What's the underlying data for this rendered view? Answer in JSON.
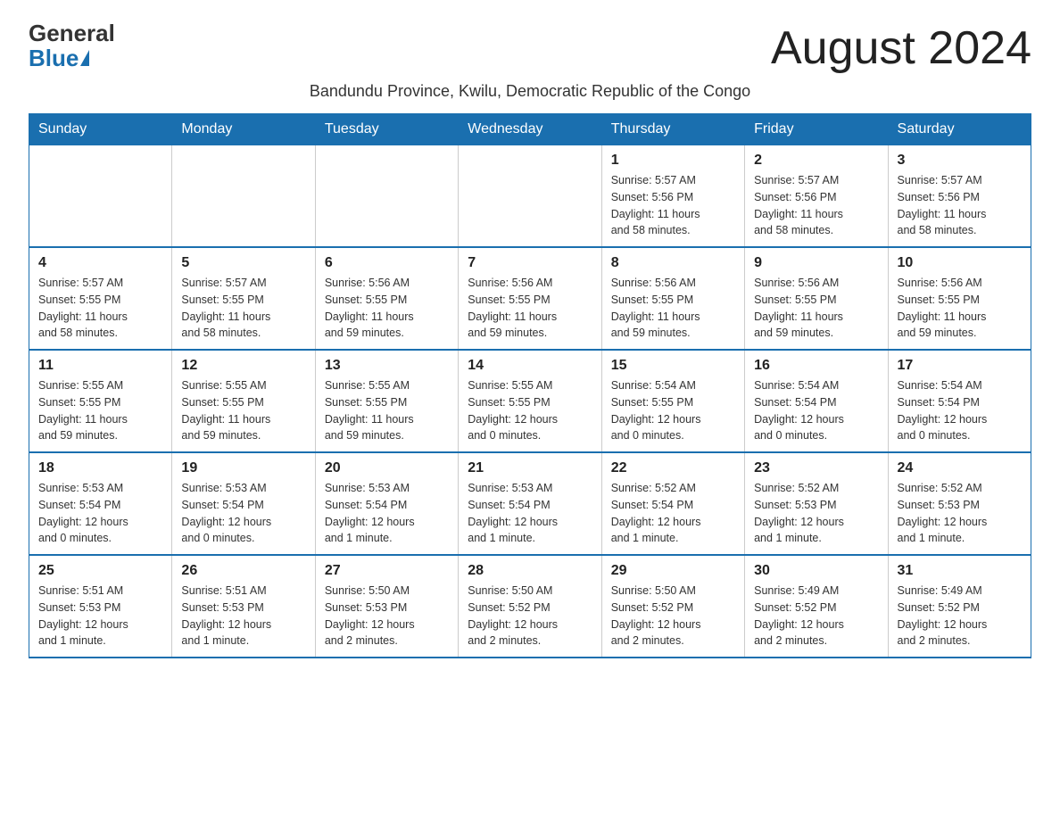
{
  "header": {
    "logo_general": "General",
    "logo_blue": "Blue",
    "month_title": "August 2024",
    "subtitle": "Bandundu Province, Kwilu, Democratic Republic of the Congo"
  },
  "days_of_week": [
    "Sunday",
    "Monday",
    "Tuesday",
    "Wednesday",
    "Thursday",
    "Friday",
    "Saturday"
  ],
  "weeks": [
    [
      {
        "day": "",
        "info": ""
      },
      {
        "day": "",
        "info": ""
      },
      {
        "day": "",
        "info": ""
      },
      {
        "day": "",
        "info": ""
      },
      {
        "day": "1",
        "info": "Sunrise: 5:57 AM\nSunset: 5:56 PM\nDaylight: 11 hours\nand 58 minutes."
      },
      {
        "day": "2",
        "info": "Sunrise: 5:57 AM\nSunset: 5:56 PM\nDaylight: 11 hours\nand 58 minutes."
      },
      {
        "day": "3",
        "info": "Sunrise: 5:57 AM\nSunset: 5:56 PM\nDaylight: 11 hours\nand 58 minutes."
      }
    ],
    [
      {
        "day": "4",
        "info": "Sunrise: 5:57 AM\nSunset: 5:55 PM\nDaylight: 11 hours\nand 58 minutes."
      },
      {
        "day": "5",
        "info": "Sunrise: 5:57 AM\nSunset: 5:55 PM\nDaylight: 11 hours\nand 58 minutes."
      },
      {
        "day": "6",
        "info": "Sunrise: 5:56 AM\nSunset: 5:55 PM\nDaylight: 11 hours\nand 59 minutes."
      },
      {
        "day": "7",
        "info": "Sunrise: 5:56 AM\nSunset: 5:55 PM\nDaylight: 11 hours\nand 59 minutes."
      },
      {
        "day": "8",
        "info": "Sunrise: 5:56 AM\nSunset: 5:55 PM\nDaylight: 11 hours\nand 59 minutes."
      },
      {
        "day": "9",
        "info": "Sunrise: 5:56 AM\nSunset: 5:55 PM\nDaylight: 11 hours\nand 59 minutes."
      },
      {
        "day": "10",
        "info": "Sunrise: 5:56 AM\nSunset: 5:55 PM\nDaylight: 11 hours\nand 59 minutes."
      }
    ],
    [
      {
        "day": "11",
        "info": "Sunrise: 5:55 AM\nSunset: 5:55 PM\nDaylight: 11 hours\nand 59 minutes."
      },
      {
        "day": "12",
        "info": "Sunrise: 5:55 AM\nSunset: 5:55 PM\nDaylight: 11 hours\nand 59 minutes."
      },
      {
        "day": "13",
        "info": "Sunrise: 5:55 AM\nSunset: 5:55 PM\nDaylight: 11 hours\nand 59 minutes."
      },
      {
        "day": "14",
        "info": "Sunrise: 5:55 AM\nSunset: 5:55 PM\nDaylight: 12 hours\nand 0 minutes."
      },
      {
        "day": "15",
        "info": "Sunrise: 5:54 AM\nSunset: 5:55 PM\nDaylight: 12 hours\nand 0 minutes."
      },
      {
        "day": "16",
        "info": "Sunrise: 5:54 AM\nSunset: 5:54 PM\nDaylight: 12 hours\nand 0 minutes."
      },
      {
        "day": "17",
        "info": "Sunrise: 5:54 AM\nSunset: 5:54 PM\nDaylight: 12 hours\nand 0 minutes."
      }
    ],
    [
      {
        "day": "18",
        "info": "Sunrise: 5:53 AM\nSunset: 5:54 PM\nDaylight: 12 hours\nand 0 minutes."
      },
      {
        "day": "19",
        "info": "Sunrise: 5:53 AM\nSunset: 5:54 PM\nDaylight: 12 hours\nand 0 minutes."
      },
      {
        "day": "20",
        "info": "Sunrise: 5:53 AM\nSunset: 5:54 PM\nDaylight: 12 hours\nand 1 minute."
      },
      {
        "day": "21",
        "info": "Sunrise: 5:53 AM\nSunset: 5:54 PM\nDaylight: 12 hours\nand 1 minute."
      },
      {
        "day": "22",
        "info": "Sunrise: 5:52 AM\nSunset: 5:54 PM\nDaylight: 12 hours\nand 1 minute."
      },
      {
        "day": "23",
        "info": "Sunrise: 5:52 AM\nSunset: 5:53 PM\nDaylight: 12 hours\nand 1 minute."
      },
      {
        "day": "24",
        "info": "Sunrise: 5:52 AM\nSunset: 5:53 PM\nDaylight: 12 hours\nand 1 minute."
      }
    ],
    [
      {
        "day": "25",
        "info": "Sunrise: 5:51 AM\nSunset: 5:53 PM\nDaylight: 12 hours\nand 1 minute."
      },
      {
        "day": "26",
        "info": "Sunrise: 5:51 AM\nSunset: 5:53 PM\nDaylight: 12 hours\nand 1 minute."
      },
      {
        "day": "27",
        "info": "Sunrise: 5:50 AM\nSunset: 5:53 PM\nDaylight: 12 hours\nand 2 minutes."
      },
      {
        "day": "28",
        "info": "Sunrise: 5:50 AM\nSunset: 5:52 PM\nDaylight: 12 hours\nand 2 minutes."
      },
      {
        "day": "29",
        "info": "Sunrise: 5:50 AM\nSunset: 5:52 PM\nDaylight: 12 hours\nand 2 minutes."
      },
      {
        "day": "30",
        "info": "Sunrise: 5:49 AM\nSunset: 5:52 PM\nDaylight: 12 hours\nand 2 minutes."
      },
      {
        "day": "31",
        "info": "Sunrise: 5:49 AM\nSunset: 5:52 PM\nDaylight: 12 hours\nand 2 minutes."
      }
    ]
  ]
}
